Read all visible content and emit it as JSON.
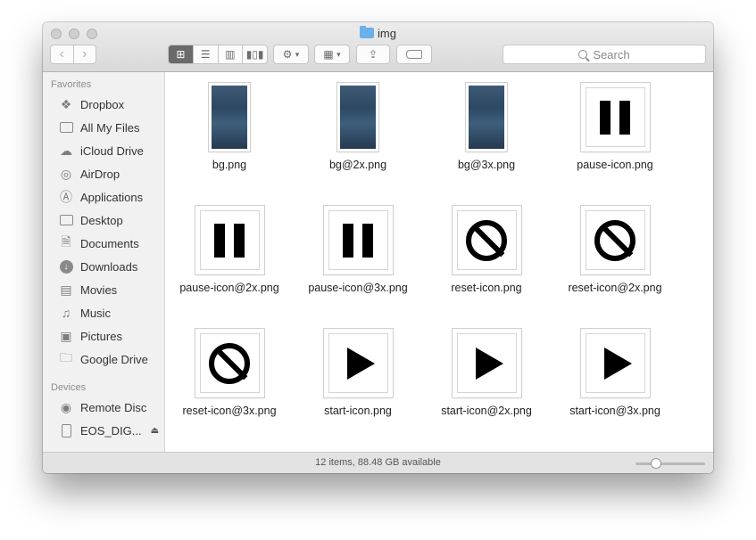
{
  "window": {
    "title": "img"
  },
  "toolbar": {
    "back_icon": "chevron-left-icon",
    "forward_icon": "chevron-right-icon",
    "view_modes": [
      "icon-view",
      "list-view",
      "column-view",
      "cover-flow-view"
    ],
    "active_view": "icon-view",
    "search_placeholder": "Search"
  },
  "sidebar": {
    "favorites_header": "Favorites",
    "favorites": [
      {
        "label": "Dropbox",
        "icon": "dropbox-icon"
      },
      {
        "label": "All My Files",
        "icon": "all-files-icon"
      },
      {
        "label": "iCloud Drive",
        "icon": "cloud-icon"
      },
      {
        "label": "AirDrop",
        "icon": "airdrop-icon"
      },
      {
        "label": "Applications",
        "icon": "applications-icon"
      },
      {
        "label": "Desktop",
        "icon": "desktop-icon"
      },
      {
        "label": "Documents",
        "icon": "documents-icon"
      },
      {
        "label": "Downloads",
        "icon": "downloads-icon"
      },
      {
        "label": "Movies",
        "icon": "movies-icon"
      },
      {
        "label": "Music",
        "icon": "music-icon"
      },
      {
        "label": "Pictures",
        "icon": "pictures-icon"
      },
      {
        "label": "Google Drive",
        "icon": "folder-icon"
      }
    ],
    "devices_header": "Devices",
    "devices": [
      {
        "label": "Remote Disc",
        "icon": "disc-icon"
      },
      {
        "label": "EOS_DIG...",
        "icon": "drive-icon"
      }
    ]
  },
  "files": [
    {
      "name": "bg.png",
      "kind": "background"
    },
    {
      "name": "bg@2x.png",
      "kind": "background"
    },
    {
      "name": "bg@3x.png",
      "kind": "background"
    },
    {
      "name": "pause-icon.png",
      "kind": "pause"
    },
    {
      "name": "pause-icon@2x.png",
      "kind": "pause"
    },
    {
      "name": "pause-icon@3x.png",
      "kind": "pause"
    },
    {
      "name": "reset-icon.png",
      "kind": "reset"
    },
    {
      "name": "reset-icon@2x.png",
      "kind": "reset"
    },
    {
      "name": "reset-icon@3x.png",
      "kind": "reset"
    },
    {
      "name": "start-icon.png",
      "kind": "start"
    },
    {
      "name": "start-icon@2x.png",
      "kind": "start"
    },
    {
      "name": "start-icon@3x.png",
      "kind": "start"
    }
  ],
  "status": {
    "text": "12 items, 88.48 GB available"
  },
  "icon_size_slider": {
    "value": 0.3
  }
}
